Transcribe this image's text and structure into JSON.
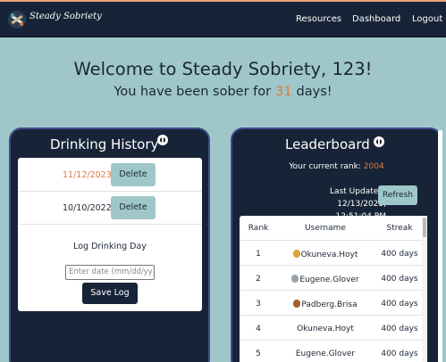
{
  "nav": {
    "brand": "Steady Sobriety",
    "links": [
      "Resources",
      "Dashboard",
      "Logout"
    ]
  },
  "welcome": {
    "heading": "Welcome to Steady Sobriety, 123!",
    "sober_prefix": "You have been sober for",
    "sober_days": "31",
    "sober_suffix": "days!"
  },
  "history": {
    "title": "Drinking History",
    "entries": [
      {
        "date": "11/12/2023",
        "date_color": "#e07a41",
        "delete_label": "Delete"
      },
      {
        "date": "10/10/2022",
        "date_color": "#1b2634",
        "delete_label": "Delete"
      }
    ],
    "log_title": "Log Drinking Day",
    "date_placeholder": "Enter date (mm/dd/yy)",
    "save_label": "Save Log"
  },
  "leaderboard": {
    "title": "Leaderboard",
    "rank_prefix": "Your current rank:",
    "rank_value": "2004",
    "updated_line1": "Last Updated: 12/13/2023,",
    "updated_line2": "12:51:04 PM",
    "refresh_label": "Refresh",
    "columns": [
      "Rank",
      "Username",
      "Streak"
    ],
    "rows": [
      {
        "rank": "1",
        "username": "Okuneva.Hoyt",
        "streak": "400 days",
        "medal": "gold"
      },
      {
        "rank": "2",
        "username": "Eugene.Glover",
        "streak": "400 days",
        "medal": "silver"
      },
      {
        "rank": "3",
        "username": "Padberg.Brisa",
        "streak": "400 days",
        "medal": "bronze"
      },
      {
        "rank": "4",
        "username": "Okuneva.Hoyt",
        "streak": "400 days",
        "medal": ""
      },
      {
        "rank": "5",
        "username": "Eugene.Glover",
        "streak": "400 days",
        "medal": ""
      }
    ]
  },
  "colors": {
    "background": "#9fc7c9",
    "navbar": "#172437",
    "panel_border": "#3f4c8e",
    "accent": "#e07a41"
  },
  "icons": {
    "logo": "dumbbell-logo-icon",
    "info": "info-icon",
    "gold": "gold-medal-icon",
    "silver": "silver-medal-icon",
    "bronze": "bronze-medal-icon"
  }
}
